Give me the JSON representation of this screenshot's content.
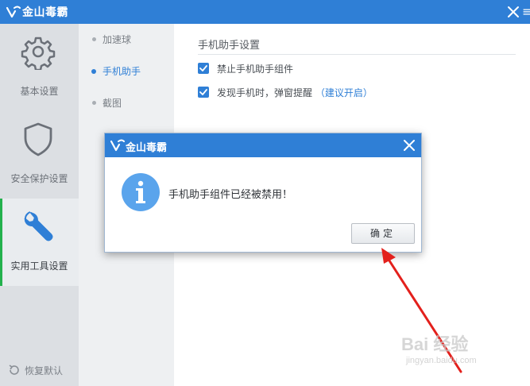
{
  "window": {
    "title": "金山毒霸",
    "extra_glyph": "≡"
  },
  "leftnav": {
    "items": [
      {
        "label": "基本设置",
        "icon": "gear-icon"
      },
      {
        "label": "安全保护设置",
        "icon": "shield-icon"
      },
      {
        "label": "实用工具设置",
        "icon": "wrench-icon",
        "active": true
      }
    ],
    "restore_label": "恢复默认"
  },
  "subnav": {
    "items": [
      {
        "label": "加速球"
      },
      {
        "label": "手机助手",
        "active": true
      },
      {
        "label": "截图"
      }
    ]
  },
  "content": {
    "section_title": "手机助手设置",
    "options": [
      {
        "label": "禁止手机助手组件",
        "checked": true,
        "hint": ""
      },
      {
        "label": "发现手机时，弹窗提醒",
        "checked": true,
        "hint": "（建议开启）"
      }
    ]
  },
  "dialog": {
    "title": "金山毒霸",
    "message": "手机助手组件已经被禁用！",
    "ok_label": "确定",
    "icon": "info-icon"
  },
  "watermark": {
    "main": "Bai 经验",
    "sub": "jingyan.baidu.com"
  },
  "colors": {
    "brand_blue": "#2f7fd6",
    "active_accent": "#23b14d",
    "arrow_red": "#e3201c"
  }
}
